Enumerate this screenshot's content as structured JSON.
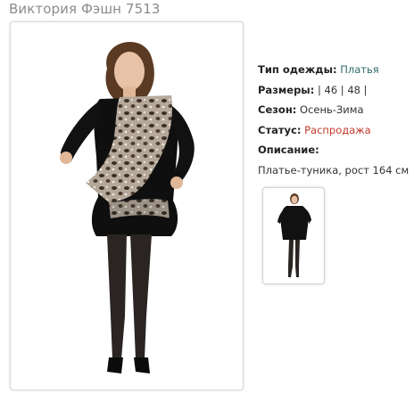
{
  "product": {
    "title": "Виктория Фэшн 7513"
  },
  "details": {
    "type_label": "Тип одежды:",
    "type_value": "Платья",
    "sizes_label": "Размеры:",
    "sizes_value": "| 46 | 48 |",
    "season_label": "Сезон:",
    "season_value": "Осень-Зима",
    "status_label": "Статус:",
    "status_value": "Распродажа",
    "description_label": "Описание:",
    "description_value": "Платье-туника, рост 164 см"
  },
  "colors": {
    "title_gray": "#8b8b8b",
    "link_teal": "#2e6b6b",
    "sale_red": "#c0392b"
  }
}
